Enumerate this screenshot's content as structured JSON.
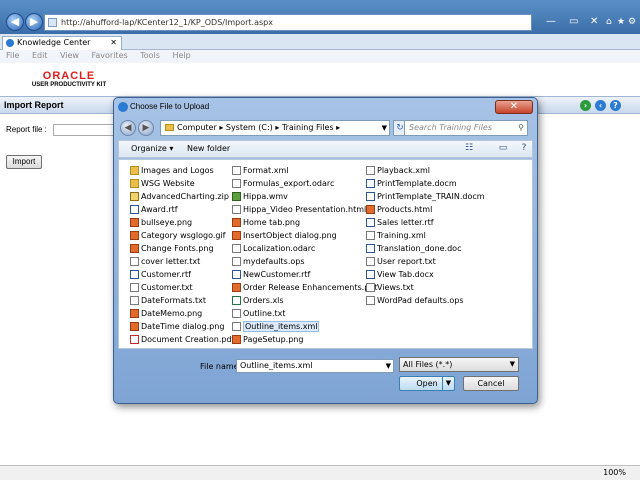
{
  "browser": {
    "url": "http://ahufford-lap/KCenter12_1/KP_ODS/Import.aspx",
    "tab_label": "Knowledge Center",
    "menu": [
      "File",
      "Edit",
      "View",
      "Favorites",
      "Tools",
      "Help"
    ],
    "zoom": "100%"
  },
  "page": {
    "logo_main": "ORACLE",
    "logo_sub": "USER PRODUCTIVITY KIT",
    "section_title": "Import Report",
    "report_label": "Report file :",
    "import_button": "Import"
  },
  "dialog": {
    "title": "Choose File to Upload",
    "path": "Computer ▸ System (C:) ▸ Training Files ▸",
    "search_placeholder": "Search Training Files",
    "organize": "Organize ▾",
    "new_folder": "New folder",
    "columns": [
      [
        {
          "name": "Images and Logos",
          "icon": "folder"
        },
        {
          "name": "WSG Website",
          "icon": "folder"
        },
        {
          "name": "AdvancedCharting.zip",
          "icon": "zip"
        },
        {
          "name": "Award.rtf",
          "icon": "word"
        },
        {
          "name": "bullseye.png",
          "icon": "img"
        },
        {
          "name": "Category wsglogo.gif",
          "icon": "img"
        },
        {
          "name": "Change Fonts.png",
          "icon": "img"
        },
        {
          "name": "cover letter.txt",
          "icon": "doc"
        },
        {
          "name": "Customer.rtf",
          "icon": "word"
        },
        {
          "name": "Customer.txt",
          "icon": "doc"
        },
        {
          "name": "DateFormats.txt",
          "icon": "doc"
        },
        {
          "name": "DateMemo.png",
          "icon": "img"
        },
        {
          "name": "DateTime dialog.png",
          "icon": "img"
        },
        {
          "name": "Document Creation.pdf",
          "icon": "pdf"
        }
      ],
      [
        {
          "name": "Format.xml",
          "icon": "doc"
        },
        {
          "name": "Formulas_export.odarc",
          "icon": "doc"
        },
        {
          "name": "Hippa.wmv",
          "icon": "media"
        },
        {
          "name": "Hippa_Video Presentation.html",
          "icon": "doc"
        },
        {
          "name": "Home tab.png",
          "icon": "img"
        },
        {
          "name": "InsertObject dialog.png",
          "icon": "img"
        },
        {
          "name": "Localization.odarc",
          "icon": "doc"
        },
        {
          "name": "mydefaults.ops",
          "icon": "doc"
        },
        {
          "name": "NewCustomer.rtf",
          "icon": "word"
        },
        {
          "name": "Order Release Enhancements.ppt",
          "icon": "img"
        },
        {
          "name": "Orders.xls",
          "icon": "xls"
        },
        {
          "name": "Outline.txt",
          "icon": "doc"
        },
        {
          "name": "Outline_items.xml",
          "icon": "doc",
          "selected": true
        },
        {
          "name": "PageSetup.png",
          "icon": "img"
        }
      ],
      [
        {
          "name": "Playback.xml",
          "icon": "doc"
        },
        {
          "name": "PrintTemplate.docm",
          "icon": "word"
        },
        {
          "name": "PrintTemplate_TRAIN.docm",
          "icon": "word"
        },
        {
          "name": "Products.html",
          "icon": "img"
        },
        {
          "name": "Sales letter.rtf",
          "icon": "word"
        },
        {
          "name": "Training.xml",
          "icon": "doc"
        },
        {
          "name": "Translation_done.doc",
          "icon": "word"
        },
        {
          "name": "User report.txt",
          "icon": "doc"
        },
        {
          "name": "View Tab.docx",
          "icon": "word"
        },
        {
          "name": "Views.txt",
          "icon": "doc"
        },
        {
          "name": "WordPad defaults.ops",
          "icon": "doc"
        }
      ]
    ],
    "file_name_label": "File name:",
    "file_name_value": "Outline_items.xml",
    "file_type": "All Files (*.*)",
    "open_button": "Open",
    "cancel_button": "Cancel"
  }
}
